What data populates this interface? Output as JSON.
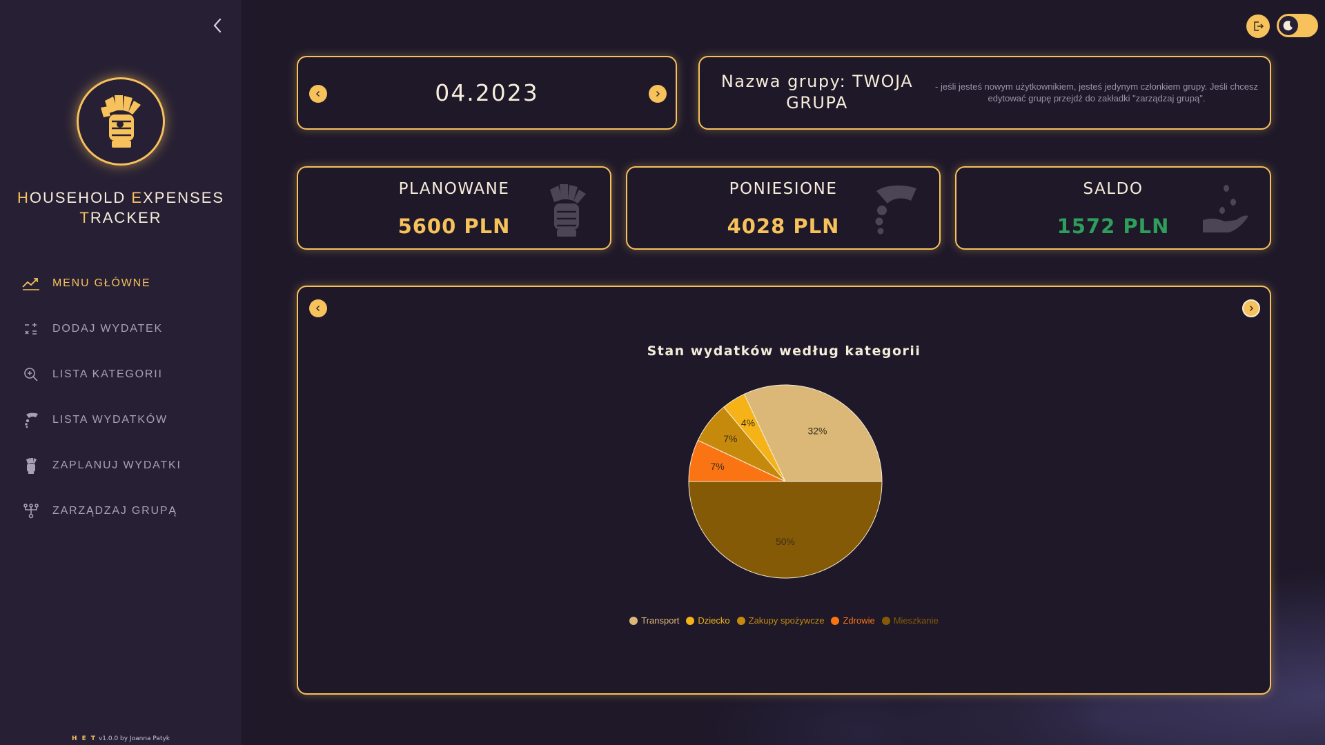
{
  "app": {
    "title_line1": [
      {
        "first": "H",
        "rest": "OUSEHOLD "
      },
      {
        "first": "E",
        "rest": "XPENSES"
      }
    ],
    "title_line2": {
      "first": "T",
      "rest": "RACKER"
    },
    "footer_brand": "H E T",
    "footer_text": "v1.0.0 by Joanna Patyk"
  },
  "sidebar": {
    "items": [
      {
        "label": "MENU GŁÓWNE",
        "icon": "trend-chart-icon",
        "active": true
      },
      {
        "label": "DODAJ WYDATEK",
        "icon": "calculator-icon",
        "active": false
      },
      {
        "label": "LISTA KATEGORII",
        "icon": "zoom-in-icon",
        "active": false
      },
      {
        "label": "LISTA WYDATKÓW",
        "icon": "hand-coins-icon",
        "active": false
      },
      {
        "label": "ZAPLANUJ WYDATKI",
        "icon": "money-fist-icon",
        "active": false
      },
      {
        "label": "ZARZĄDZAJ GRUPĄ",
        "icon": "group-tree-icon",
        "active": false
      }
    ]
  },
  "date_card": {
    "date": "04.2023"
  },
  "group_card": {
    "name": "Nazwa grupy: TWOJA GRUPA",
    "hint": "- jeśli jesteś nowym użytkownikiem, jesteś jedynym członkiem grupy. Jeśli chcesz edytować grupę przejdź do zakładki \"zarządzaj grupą\"."
  },
  "stats": [
    {
      "label": "PLANOWANE",
      "value": "5600 PLN",
      "color": "#f7c25c",
      "icon": "money-fist-icon"
    },
    {
      "label": "PONIESIONE",
      "value": "4028 PLN",
      "color": "#f7c25c",
      "icon": "hand-coins-icon"
    },
    {
      "label": "SALDO",
      "value": "1572 PLN",
      "color": "#2e9e5b",
      "icon": "hand-seed-icon"
    }
  ],
  "chart_data": {
    "type": "pie",
    "title": "Stan wydatków według kategorii",
    "slices": [
      {
        "name": "Transport",
        "percent": 32,
        "label": "32%",
        "color": "#dcb878"
      },
      {
        "name": "Dziecko",
        "percent": 4,
        "label": "4%",
        "color": "#f5b318"
      },
      {
        "name": "Zakupy spożywcze",
        "percent": 7,
        "label": "7%",
        "color": "#c58a0c"
      },
      {
        "name": "Zdrowie",
        "percent": 7,
        "label": "7%",
        "color": "#fa7414"
      },
      {
        "name": "Mieszkanie",
        "percent": 50,
        "label": "50%",
        "color": "#845a06"
      }
    ],
    "legend_position": "bottom"
  }
}
